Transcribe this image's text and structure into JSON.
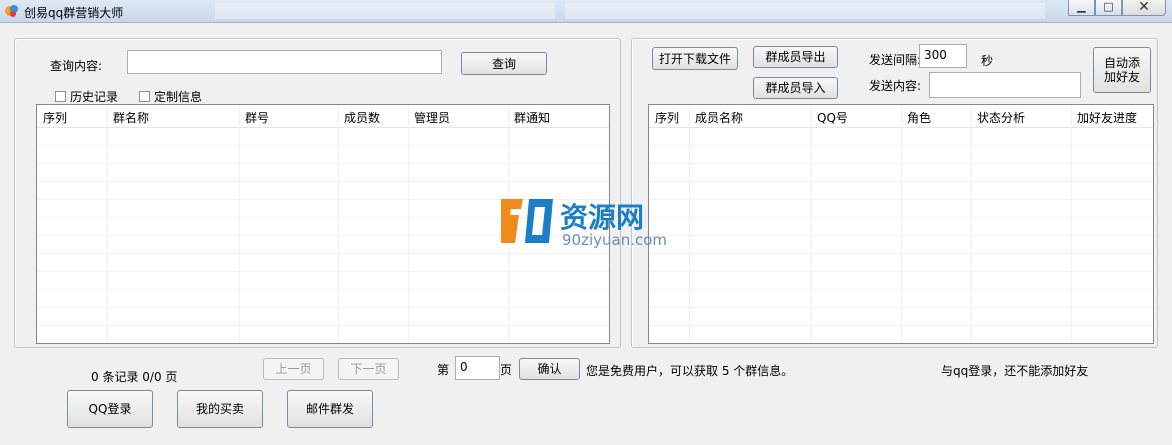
{
  "window": {
    "title": "创易qq群营销大师"
  },
  "left": {
    "query_label": "查询内容:",
    "query_value": "",
    "query_button": "查询",
    "history_checkbox": "历史记录",
    "custom_checkbox": "定制信息",
    "columns": [
      "序列",
      "群名称",
      "群号",
      "成员数",
      "管理员",
      "群通知"
    ]
  },
  "right": {
    "open_download_button": "打开下载文件",
    "export_members_button": "群成员导出",
    "import_members_button": "群成员导入",
    "interval_label": "发送间隔:",
    "interval_value": "300",
    "seconds_label": "秒",
    "content_label": "发送内容:",
    "content_value": "",
    "auto_add_button": "自动添加好友",
    "columns": [
      "序列",
      "成员名称",
      "QQ号",
      "角色",
      "状态分析",
      "加好友进度"
    ]
  },
  "footer": {
    "record_count": "0 条记录 0/0 页",
    "prev_button": "上一页",
    "next_button": "下一页",
    "page_prefix": "第",
    "page_value": "0",
    "page_suffix": "页",
    "confirm_button": "确认",
    "free_user_notice": "您是免费用户，可以获取 5 个群信息。",
    "login_notice": "与qq登录，还不能添加好友",
    "qq_login_button": "QQ登录",
    "my_purchase_button": "我的买卖",
    "mail_mass_button": "邮件群发"
  },
  "watermark": {
    "brand": "资源网",
    "domain": "90ziyuan.com"
  },
  "colors": {
    "accent": "#1d7ec6",
    "watermark_orange": "#f08a1c"
  }
}
